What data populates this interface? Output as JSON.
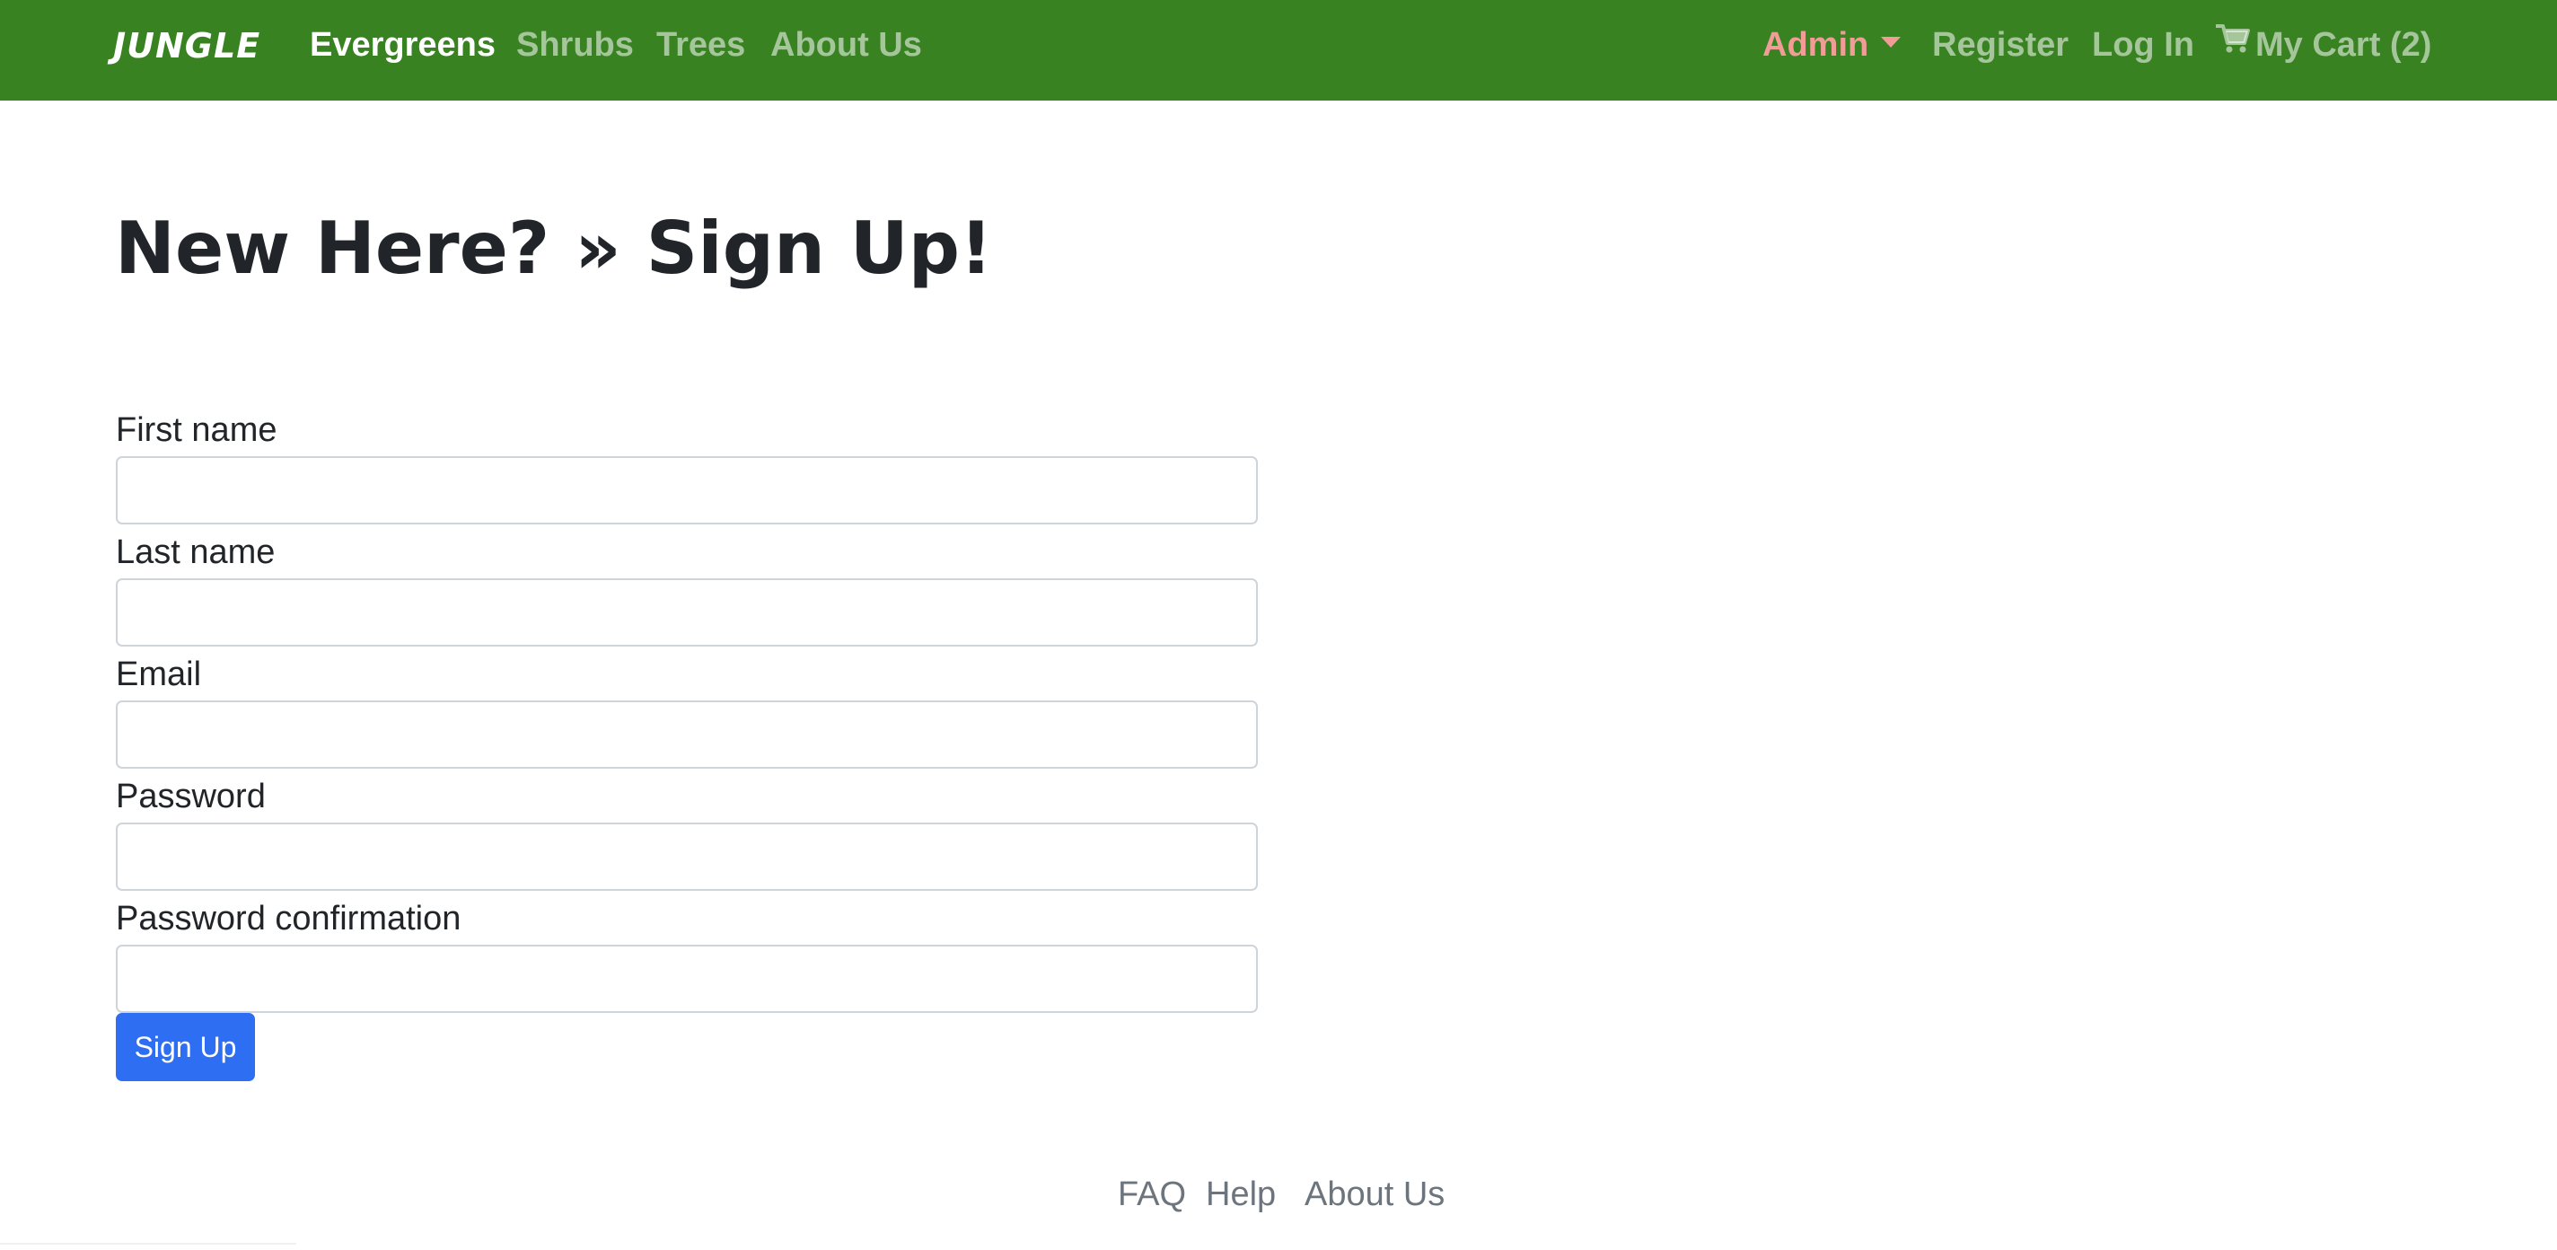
{
  "navbar": {
    "brand": "JUNGLE",
    "background_color": "#388222",
    "admin_color": "#f19c96",
    "left_links": [
      {
        "label": "Evergreens",
        "active": true
      },
      {
        "label": "Shrubs",
        "active": false
      },
      {
        "label": "Trees",
        "active": false
      },
      {
        "label": "About Us",
        "active": false
      }
    ],
    "right_links": {
      "admin": "Admin",
      "register": "Register",
      "login": "Log In",
      "cart": "My Cart (2)"
    },
    "icons": {
      "admin_dropdown": "chevron-down-icon",
      "cart": "shopping-cart-icon"
    }
  },
  "main": {
    "title": "New Here? » Sign Up!",
    "form": {
      "fields": [
        {
          "label": "First name",
          "value": "",
          "placeholder": ""
        },
        {
          "label": "Last name",
          "value": "",
          "placeholder": ""
        },
        {
          "label": "Email",
          "value": "",
          "placeholder": ""
        },
        {
          "label": "Password",
          "value": "",
          "placeholder": ""
        },
        {
          "label": "Password confirmation",
          "value": "",
          "placeholder": ""
        }
      ],
      "submit_label": "Sign Up",
      "submit_color": "#2e6ef3"
    }
  },
  "footer": {
    "links": [
      "FAQ",
      "Help",
      "About Us"
    ]
  }
}
